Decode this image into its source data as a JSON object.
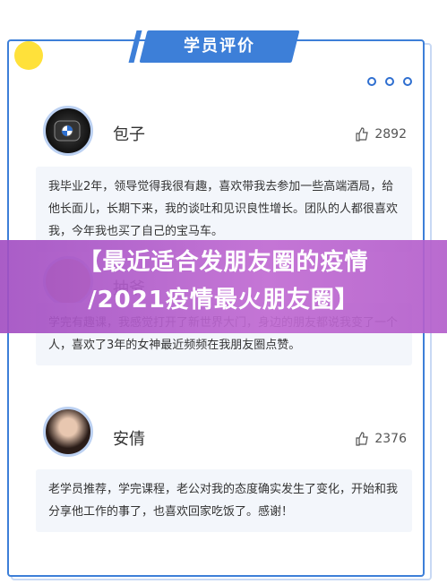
{
  "header": {
    "title": "学员评价"
  },
  "reviews": [
    {
      "name": "包子",
      "likes": "2892",
      "comment": "我毕业2年，领导觉得我很有趣，喜欢带我去参加一些高端酒局，给他长面儿，长期下来，我的谈吐和见识良性增长。团队的人都很喜欢我，今年我也买了自己的宝马车。"
    },
    {
      "name": "抽爷",
      "likes": "",
      "comment": "学完有趣课，我感觉打开了新世界大门，身边的朋友都说我变了一个人，喜欢了3年的女神最近频频在我朋友圈点赞。"
    },
    {
      "name": "安倩",
      "likes": "2376",
      "comment": "老学员推荐，学完课程，老公对我的态度确实发生了变化，开始和我分享他工作的事了，也喜欢回家吃饭了。感谢！"
    }
  ],
  "banner": {
    "line1": "【最近适合发朋友圈的疫情",
    "line2": "/2021疫情最火朋友圈】"
  },
  "colors": {
    "accent": "#3d7fd8",
    "yellow": "#ffe13a",
    "banner": "#b35ecb"
  }
}
